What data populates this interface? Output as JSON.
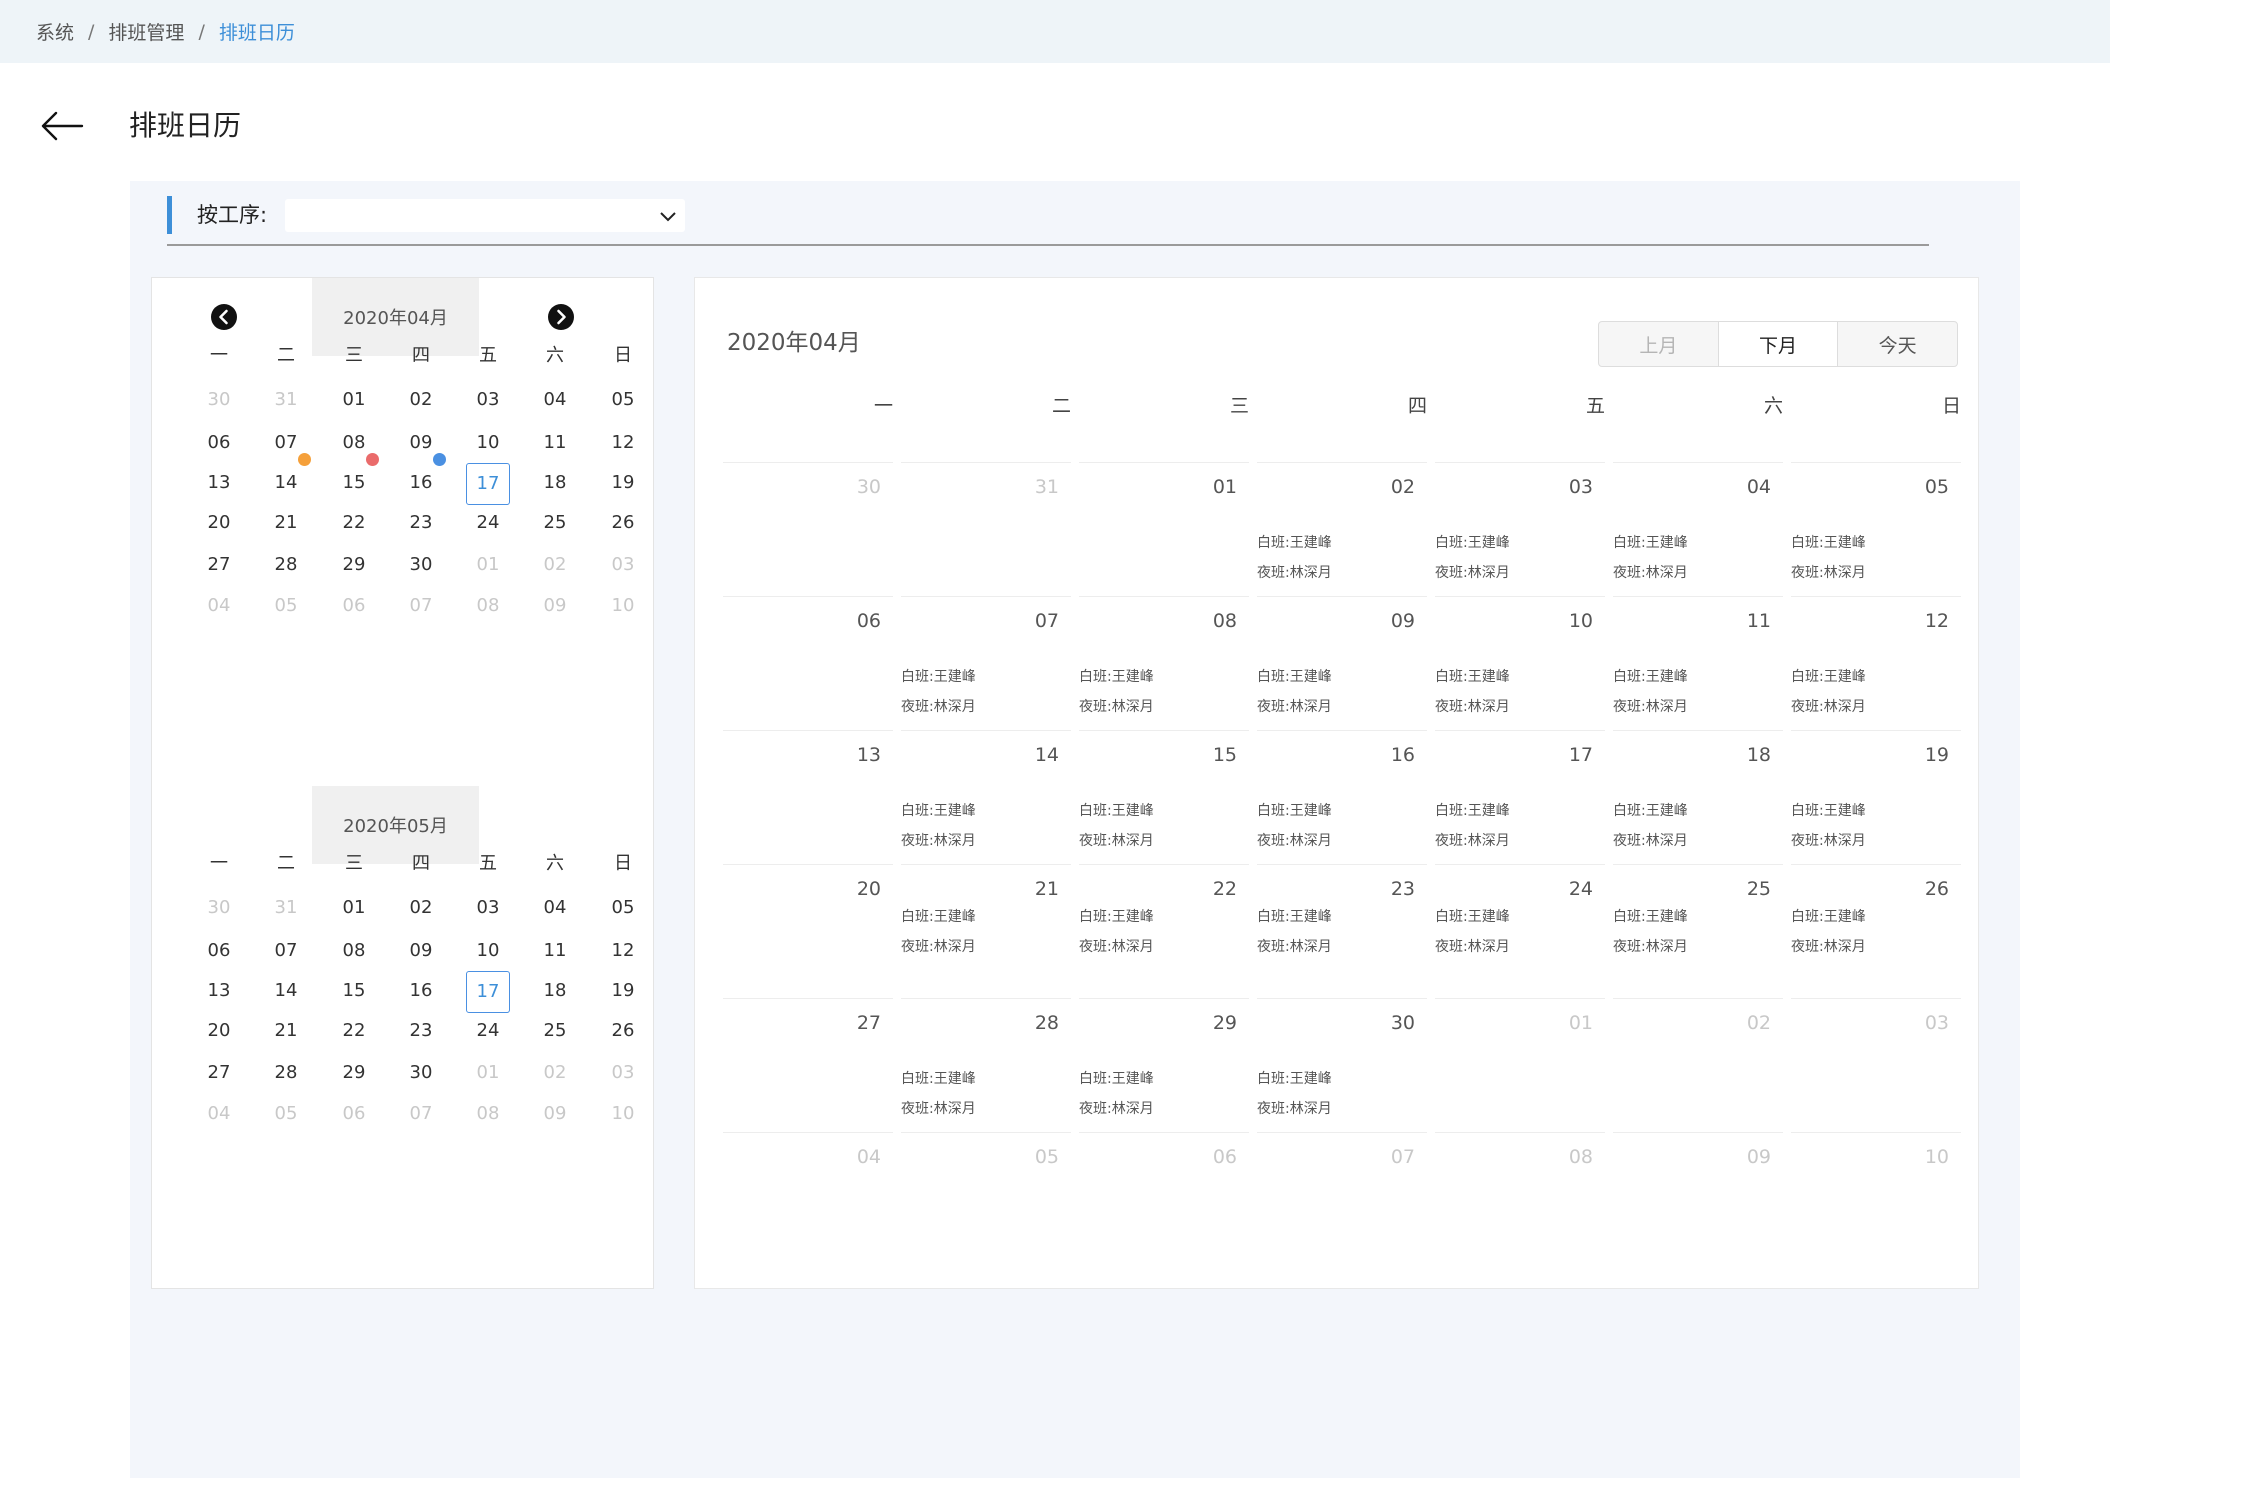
{
  "breadcrumb": [
    "系统",
    "排班管理",
    "排班日历"
  ],
  "breadcrumb_sep": "/",
  "page_title": "排班日历",
  "filter": {
    "label": "按工序:",
    "value": ""
  },
  "weekdays": [
    "一",
    "二",
    "三",
    "四",
    "五",
    "六",
    "日"
  ],
  "mini_calendars": [
    {
      "title": "2020年04月",
      "has_nav": true,
      "selected": "17",
      "days": [
        "30",
        "31",
        "01",
        "02",
        "03",
        "04",
        "05",
        "06",
        "07",
        "08",
        "09",
        "10",
        "11",
        "12",
        "13",
        "14",
        "15",
        "16",
        "17",
        "18",
        "19",
        "20",
        "21",
        "22",
        "23",
        "24",
        "25",
        "26",
        "27",
        "28",
        "29",
        "30",
        "01",
        "02",
        "03",
        "04",
        "05",
        "06",
        "07",
        "08",
        "09",
        "10"
      ],
      "other_month": [
        0,
        1,
        32,
        33,
        34,
        35,
        36,
        37,
        38,
        39,
        40,
        41
      ],
      "dots": [
        {
          "day_index": 15,
          "color": "#f5a03a"
        },
        {
          "day_index": 16,
          "color": "#ea6b6b"
        },
        {
          "day_index": 17,
          "color": "#4a90e2"
        }
      ]
    },
    {
      "title": "2020年05月",
      "has_nav": false,
      "selected": "17",
      "days": [
        "30",
        "31",
        "01",
        "02",
        "03",
        "04",
        "05",
        "06",
        "07",
        "08",
        "09",
        "10",
        "11",
        "12",
        "13",
        "14",
        "15",
        "16",
        "17",
        "18",
        "19",
        "20",
        "21",
        "22",
        "23",
        "24",
        "25",
        "26",
        "27",
        "28",
        "29",
        "30",
        "01",
        "02",
        "03",
        "04",
        "05",
        "06",
        "07",
        "08",
        "09",
        "10"
      ],
      "other_month": [
        0,
        1,
        32,
        33,
        34,
        35,
        36,
        37,
        38,
        39,
        40,
        41
      ],
      "dots": []
    }
  ],
  "big_calendar": {
    "title": "2020年04月",
    "buttons": {
      "prev": "上月",
      "next": "下月",
      "today": "今天"
    },
    "shift_labels": {
      "day": "白班:",
      "night": "夜班:"
    },
    "staff": {
      "day": "王建峰",
      "night": "林深月"
    },
    "days": [
      "30",
      "31",
      "01",
      "02",
      "03",
      "04",
      "05",
      "06",
      "07",
      "08",
      "09",
      "10",
      "11",
      "12",
      "13",
      "14",
      "15",
      "16",
      "17",
      "18",
      "19",
      "20",
      "21",
      "22",
      "23",
      "24",
      "25",
      "26",
      "27",
      "28",
      "29",
      "30",
      "01",
      "02",
      "03",
      "04",
      "05",
      "06",
      "07",
      "08",
      "09",
      "10"
    ],
    "other_month": [
      0,
      1,
      32,
      33,
      34,
      35,
      36,
      37,
      38,
      39,
      40,
      41
    ],
    "scheduled_days": [
      3,
      4,
      5,
      6,
      8,
      9,
      10,
      11,
      12,
      13,
      15,
      16,
      17,
      18,
      19,
      20,
      22,
      23,
      24,
      25,
      26,
      27,
      29,
      30,
      31
    ]
  },
  "colors": {
    "accent": "#3d8fd8",
    "panel_bg": "#f3f6fb",
    "breadcrumb_bg": "#eef4f8"
  }
}
